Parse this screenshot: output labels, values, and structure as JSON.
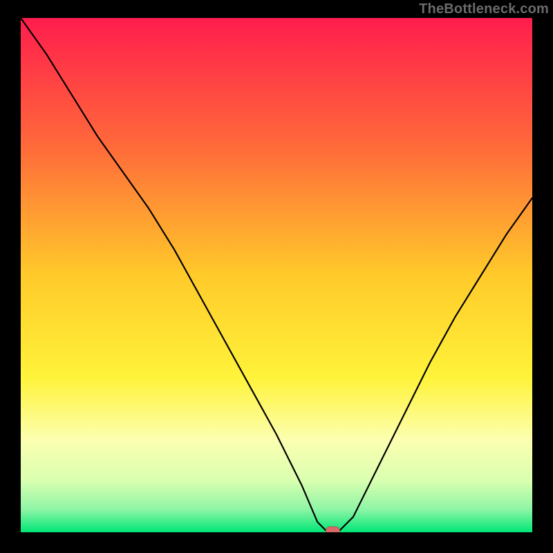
{
  "attribution": "TheBottleneck.com",
  "chart_data": {
    "type": "line",
    "title": "",
    "xlabel": "",
    "ylabel": "",
    "xlim": [
      0,
      100
    ],
    "ylim": [
      0,
      100
    ],
    "grid": false,
    "legend": false,
    "series": [
      {
        "name": "bottleneck-curve",
        "x": [
          0,
          5,
          10,
          15,
          20,
          25,
          30,
          35,
          40,
          45,
          50,
          55,
          58,
          60,
          62,
          65,
          70,
          75,
          80,
          85,
          90,
          95,
          100
        ],
        "y": [
          100,
          93,
          85,
          77,
          70,
          63,
          55,
          46,
          37,
          28,
          19,
          9,
          2,
          0,
          0,
          3,
          13,
          23,
          33,
          42,
          50,
          58,
          65
        ]
      }
    ],
    "marker": {
      "x": 61,
      "y": 0,
      "color": "#d96a6a"
    },
    "background_gradient": {
      "stops": [
        {
          "pos": 0.0,
          "color": "#ff1d4d"
        },
        {
          "pos": 0.25,
          "color": "#ff6a3a"
        },
        {
          "pos": 0.5,
          "color": "#ffca2a"
        },
        {
          "pos": 0.7,
          "color": "#fff33a"
        },
        {
          "pos": 0.82,
          "color": "#fcffb0"
        },
        {
          "pos": 0.9,
          "color": "#d9ffb0"
        },
        {
          "pos": 0.955,
          "color": "#8ff5a6"
        },
        {
          "pos": 1.0,
          "color": "#00e676"
        }
      ]
    }
  }
}
